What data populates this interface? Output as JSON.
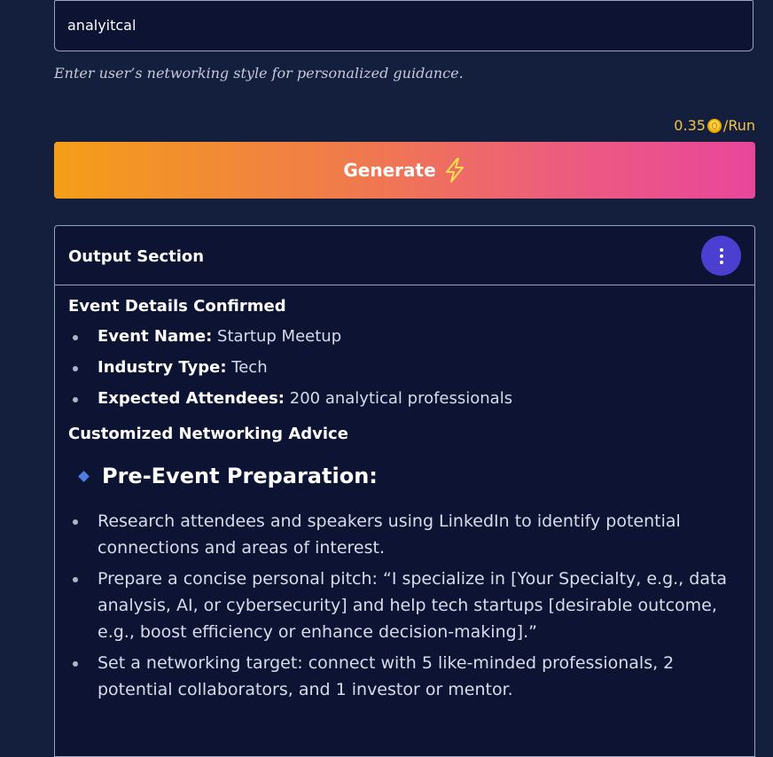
{
  "input": {
    "value": "analyitcal"
  },
  "helper_text": "Enter user’s networking style for personalized guidance.",
  "cost": {
    "amount": "0.35",
    "unit": "/Run",
    "icon": "coin-icon"
  },
  "generate_button": {
    "label": "Generate",
    "icon": "lightning-icon"
  },
  "output": {
    "title": "Output Section",
    "menu_icon": "more-vertical-icon",
    "event_heading": "Event Details Confirmed",
    "event_details": [
      {
        "label": "Event Name:",
        "value": " Startup Meetup"
      },
      {
        "label": "Industry Type:",
        "value": " Tech"
      },
      {
        "label": "Expected Attendees:",
        "value": " 200 analytical professionals"
      }
    ],
    "advice_heading": "Customized Networking Advice",
    "pre_event_title": "Pre-Event Preparation:",
    "pre_event_items": [
      "Research attendees and speakers using LinkedIn to identify potential connections and areas of interest.",
      "Prepare a concise personal pitch: “I specialize in [Your Specialty, e.g., data analysis, AI, or cybersecurity] and help tech startups [desirable outcome, e.g., boost efficiency or enhance decision-making].”",
      "Set a networking target: connect with 5 like-minded professionals, 2 potential collaborators, and 1 investor or mentor."
    ]
  },
  "colors": {
    "background": "#141e3d",
    "panel": "#0d1433",
    "accent_start": "#f49e18",
    "accent_end": "#e9469b",
    "menu_button": "#4a3fd0",
    "cost_text": "#f4c542",
    "diamond": "#4b7fe3"
  }
}
